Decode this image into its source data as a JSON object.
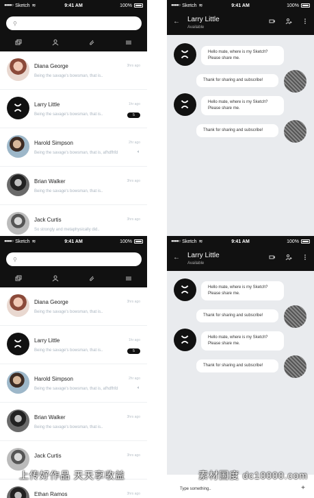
{
  "status": {
    "carrier": "Sketch",
    "time": "9:41 AM",
    "battery": "100%"
  },
  "list": {
    "search_placeholder": "",
    "contacts": [
      {
        "name": "Diana George",
        "preview": "Being the savage's bowsman, that is..",
        "time": "3hrs ago"
      },
      {
        "name": "Larry Little",
        "preview": "Being the savage's bowsman, that is..",
        "time": "1hr ago",
        "badge": "5"
      },
      {
        "name": "Harold Simpson",
        "preview": "Being the savage's bowsman, that is, afhdfhfd",
        "time": "2hr ago"
      },
      {
        "name": "Brian Walker",
        "preview": "Being the savage's bowsman, that is..",
        "time": "3hrs ago"
      },
      {
        "name": "Jack Curtis",
        "preview": "So strongly and metaphysically did..",
        "time": "3hrs ago"
      },
      {
        "name": "Ethan Ramos",
        "preview": "",
        "time": "3hrs ago"
      }
    ]
  },
  "chat": {
    "title": "Larry Little",
    "status": "Available",
    "messages": [
      {
        "text": "Hello mate, where is my Sketch? Please share me."
      },
      {
        "text": "Thank for sharing and subscribe!"
      }
    ],
    "input_placeholder": "Type something..",
    "plus": "+"
  },
  "watermark": {
    "left": "上传好作品 天天享收益",
    "right": "素材国度 dc10000.com"
  },
  "icons": {
    "tabs": [
      "chats-icon",
      "person-icon",
      "attachment-icon",
      "menu-icon"
    ],
    "chat_header": [
      "video-icon",
      "add-person-icon",
      "more-icon"
    ]
  }
}
